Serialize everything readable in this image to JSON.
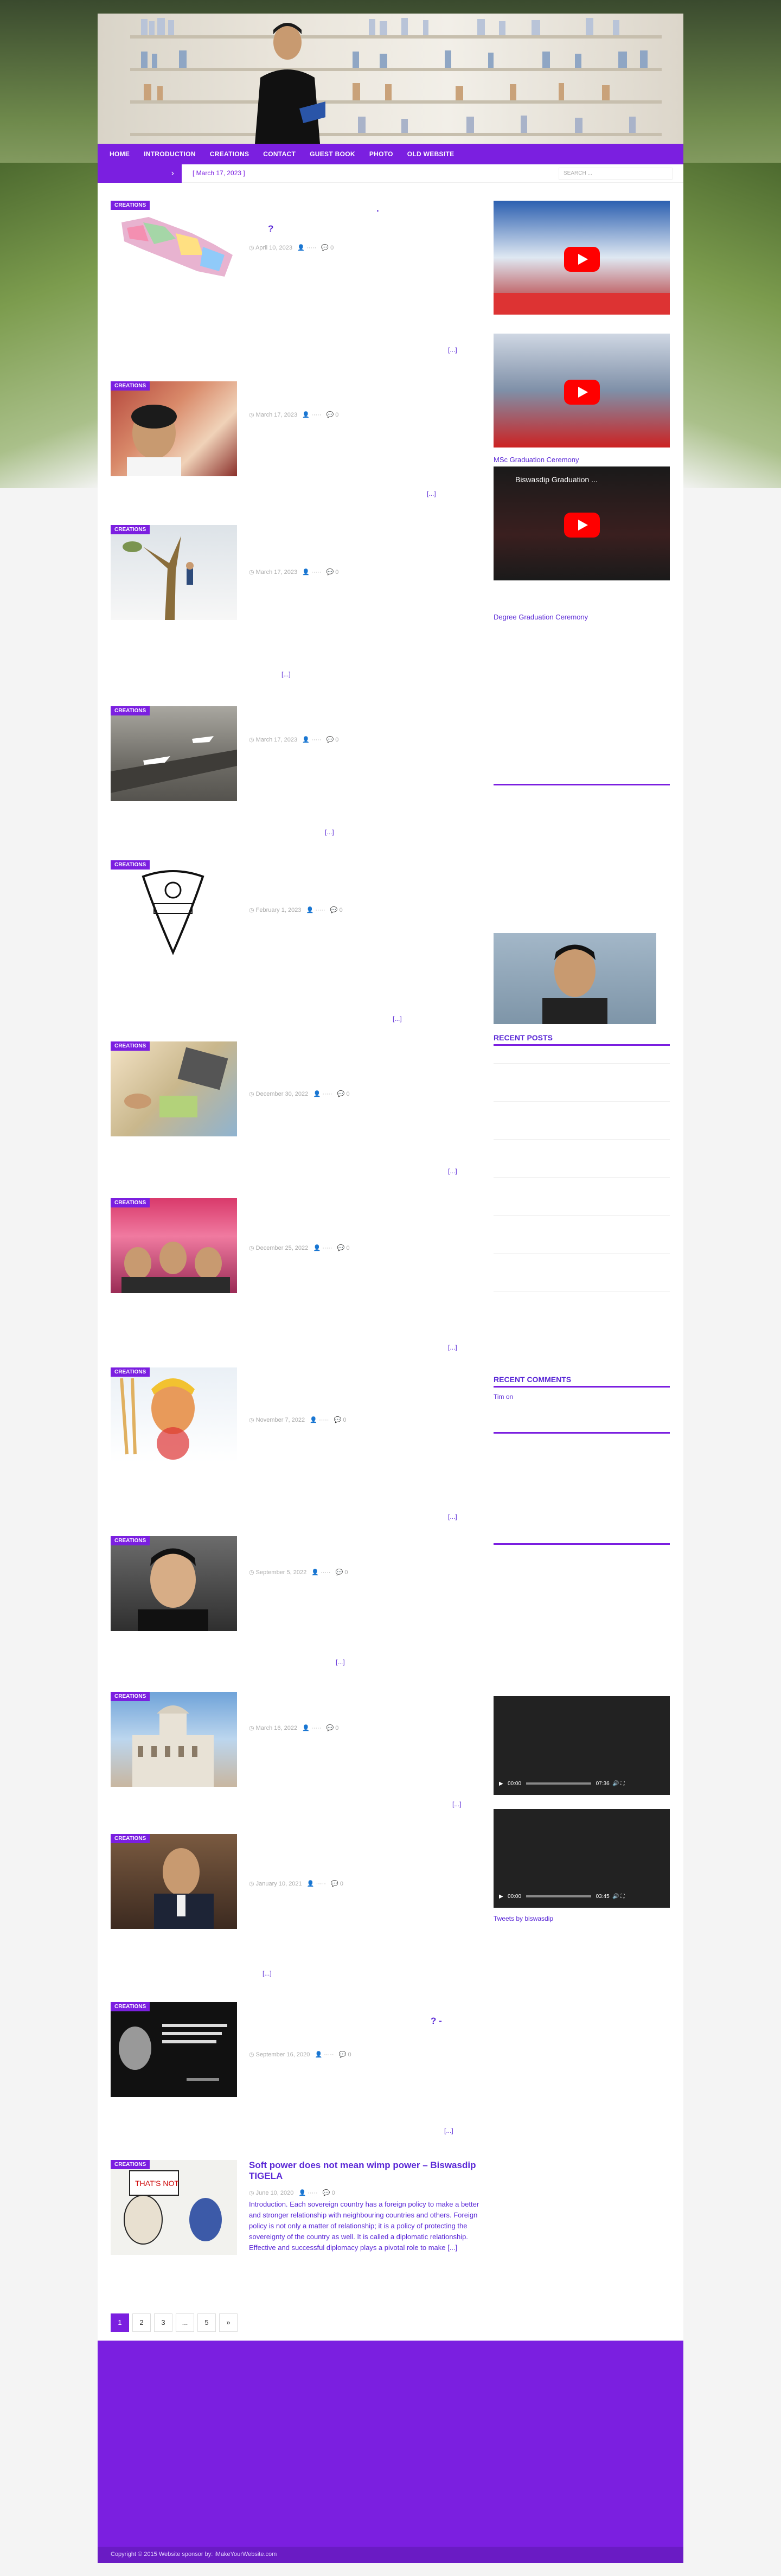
{
  "header": {
    "alt": "Biswasdip Tigela"
  },
  "nav": {
    "items": [
      "HOME",
      "INTRODUCTION",
      "CREATIONS",
      "CONTACT",
      "GUEST BOOK",
      "PHOTO",
      "OLD WEBSITE"
    ]
  },
  "ticker": {
    "arrow": "›",
    "date": "[ March 17, 2023 ]",
    "search_placeholder": "SEARCH ..."
  },
  "posts": [
    {
      "category": "CREATIONS",
      "date": "April 10, 2023",
      "comments": "0",
      "more": "[...]"
    },
    {
      "category": "CREATIONS",
      "date": "March 17, 2023",
      "comments": "0",
      "more": "[...]"
    },
    {
      "category": "CREATIONS",
      "date": "March 17, 2023",
      "comments": "0",
      "more": "[...]"
    },
    {
      "category": "CREATIONS",
      "date": "March 17, 2023",
      "comments": "0",
      "more": "[...]"
    },
    {
      "category": "CREATIONS",
      "date": "February 1, 2023",
      "comments": "0",
      "more": "[...]"
    },
    {
      "category": "CREATIONS",
      "date": "December 30, 2022",
      "comments": "0",
      "more": "[...]"
    },
    {
      "category": "CREATIONS",
      "date": "December 25, 2022",
      "comments": "0",
      "more": "[...]"
    },
    {
      "category": "CREATIONS",
      "date": "November 7, 2022",
      "comments": "0",
      "more": "[...]"
    },
    {
      "category": "CREATIONS",
      "date": "September 5, 2022",
      "comments": "0",
      "more": "[...]"
    },
    {
      "category": "CREATIONS",
      "date": "March 16, 2022",
      "comments": "0",
      "more": "[...]"
    },
    {
      "category": "CREATIONS",
      "date": "January 10, 2021",
      "comments": "0",
      "more": "[...]"
    },
    {
      "category": "CREATIONS",
      "date": "September 16, 2020",
      "comments": "0",
      "more": "[...]"
    },
    {
      "category": "CREATIONS",
      "date": "June 10, 2020",
      "comments": "0",
      "more": "[...]",
      "title": "Soft power does not mean wimp power – Biswasdip TIGELA",
      "excerpt": "Introduction. Each sovereign country has a foreign policy to make a better and stronger relationship with neighbouring countries and others. Foreign policy is not only a matter of relationship; it is a policy of protecting the sovereignty of the country as well. It is called a diplomatic relationship. Effective and successful diplomacy plays a pivotal role to make [...]"
    }
  ],
  "sidebar": {
    "msc_label": "MSc Graduation Ceremony",
    "yt3_title": "Biswasdip Graduation ...",
    "degree_label": "Degree Graduation Ceremony",
    "recent_posts": "RECENT POSTS",
    "recent_comments": "RECENT COMMENTS",
    "comment_author": "Tim on",
    "tweets": "Tweets by biswasdip",
    "video1_time": "00:00",
    "video1_total": "07:36",
    "video2_time": "00:00",
    "video2_total": "03:45"
  },
  "pagination": [
    "1",
    "2",
    "3",
    "...",
    "5",
    "»"
  ],
  "footer": {
    "copyright": "Copyright © 2015 Website sponsor by: iMakeYourWebsite.com"
  },
  "colors": {
    "accent": "#7b1fe0",
    "link": "#5a28d6"
  }
}
